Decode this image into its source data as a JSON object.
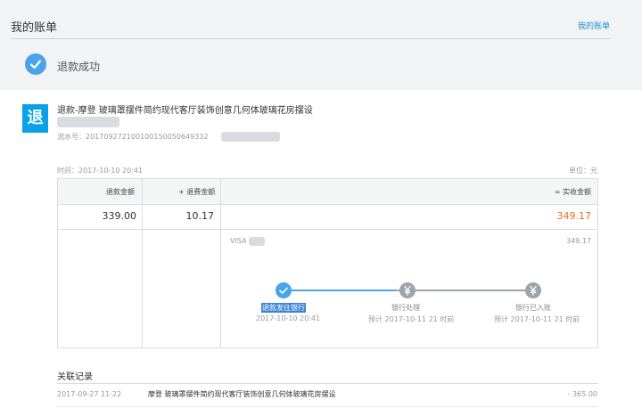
{
  "header": {
    "title": "我的账单",
    "my_bills_link": "我的账单",
    "status_text": "退款成功",
    "check_icon": "check-icon"
  },
  "transaction": {
    "badge": "退",
    "title": "退款-摩登 玻璃罩摆件简约现代客厅装饰创意几何体玻璃花房摆设",
    "serial_label": "流水号：",
    "serial_visible": "201709272100100150050649332"
  },
  "meta": {
    "time_label": "时间：",
    "time_value": "2017-10-10 20:41",
    "unit": "单位：元"
  },
  "amount_table": {
    "headers": {
      "refund_amount": "退款金额",
      "refund_fee": "+ 退费金额",
      "actual_received": "= 实收金额"
    },
    "values": {
      "refund_amount": "339.00",
      "refund_fee": "10.17",
      "actual_received": "349.17"
    },
    "total_color": "#f06d20"
  },
  "refund_progress": {
    "channel": "VISA",
    "channel_amount": "349.17",
    "active_color": "#4aa4e9",
    "inactive_color": "#9ea4ab",
    "steps": [
      {
        "label": "退款发往银行",
        "sub": "2017-10-10 20:41",
        "state": "done",
        "icon": "check-icon"
      },
      {
        "label": "银行处理",
        "sub": "预计 2017-10-11 21 时前",
        "state": "pending",
        "icon": "yen-icon"
      },
      {
        "label": "银行已入账",
        "sub": "预计 2017-10-11 21 时前",
        "state": "pending",
        "icon": "yen-icon"
      }
    ]
  },
  "related": {
    "title": "关联记录",
    "records": [
      {
        "date": "2017-09-27 11:22",
        "name": "摩登 玻璃罩摆件简约现代客厅装饰创意几何体玻璃花房摆设",
        "amount": "- 365.00"
      }
    ]
  }
}
